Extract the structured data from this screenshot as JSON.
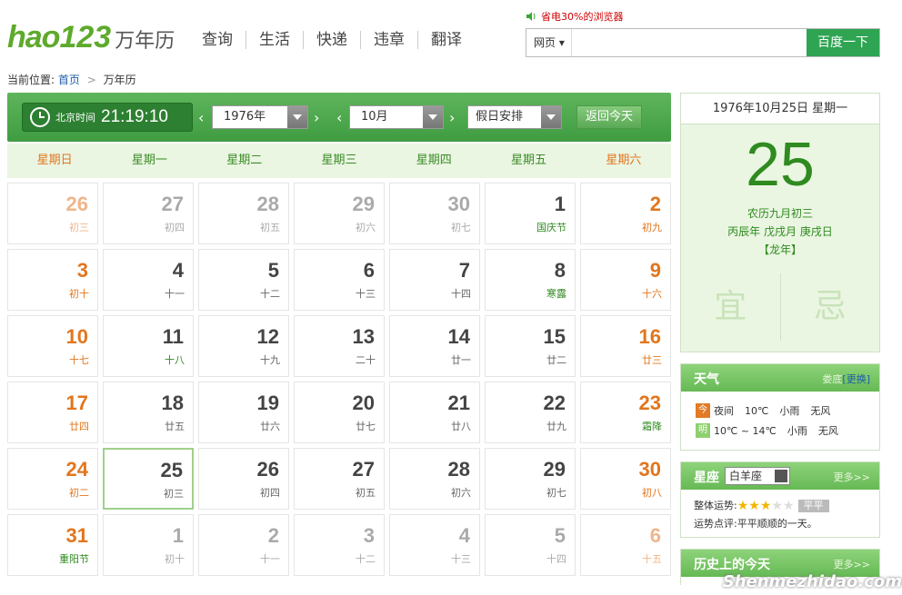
{
  "logo": {
    "hao": "hao",
    "num": "123",
    "suffix": "万年历"
  },
  "topnav": [
    "查询",
    "生活",
    "快递",
    "违章",
    "翻译"
  ],
  "promo": "省电30%的浏览器",
  "search": {
    "scope": "网页",
    "button": "百度一下",
    "placeholder": ""
  },
  "breadcrumb": {
    "prefix": "当前位置:",
    "home": "首页",
    "sep": ">",
    "current": "万年历"
  },
  "toolbar": {
    "clock_label": "北京时间",
    "time": "21:19:10",
    "prev": "‹",
    "next": "›",
    "year": "1976年",
    "month": "10月",
    "holiday": "假日安排",
    "today_button": "返回今天"
  },
  "weekdays": [
    "星期日",
    "星期一",
    "星期二",
    "星期三",
    "星期四",
    "星期五",
    "星期六"
  ],
  "days": [
    {
      "d": "26",
      "l": "初三",
      "out": true
    },
    {
      "d": "27",
      "l": "初四",
      "out": true
    },
    {
      "d": "28",
      "l": "初五",
      "out": true
    },
    {
      "d": "29",
      "l": "初六",
      "out": true
    },
    {
      "d": "30",
      "l": "初七",
      "out": true
    },
    {
      "d": "1",
      "l": "国庆节",
      "fest": true
    },
    {
      "d": "2",
      "l": "初九"
    },
    {
      "d": "3",
      "l": "初十"
    },
    {
      "d": "4",
      "l": "十一"
    },
    {
      "d": "5",
      "l": "十二"
    },
    {
      "d": "6",
      "l": "十三"
    },
    {
      "d": "7",
      "l": "十四"
    },
    {
      "d": "8",
      "l": "寒露",
      "fest": true
    },
    {
      "d": "9",
      "l": "十六"
    },
    {
      "d": "10",
      "l": "十七"
    },
    {
      "d": "11",
      "l": "十八",
      "fest": true
    },
    {
      "d": "12",
      "l": "十九"
    },
    {
      "d": "13",
      "l": "二十"
    },
    {
      "d": "14",
      "l": "廿一"
    },
    {
      "d": "15",
      "l": "廿二"
    },
    {
      "d": "16",
      "l": "廿三"
    },
    {
      "d": "17",
      "l": "廿四"
    },
    {
      "d": "18",
      "l": "廿五"
    },
    {
      "d": "19",
      "l": "廿六"
    },
    {
      "d": "20",
      "l": "廿七"
    },
    {
      "d": "21",
      "l": "廿八"
    },
    {
      "d": "22",
      "l": "廿九"
    },
    {
      "d": "23",
      "l": "霜降",
      "fest": true
    },
    {
      "d": "24",
      "l": "初二"
    },
    {
      "d": "25",
      "l": "初三",
      "sel": true
    },
    {
      "d": "26",
      "l": "初四"
    },
    {
      "d": "27",
      "l": "初五"
    },
    {
      "d": "28",
      "l": "初六"
    },
    {
      "d": "29",
      "l": "初七"
    },
    {
      "d": "30",
      "l": "初八"
    },
    {
      "d": "31",
      "l": "重阳节",
      "fest": true
    },
    {
      "d": "1",
      "l": "初十",
      "out": true
    },
    {
      "d": "2",
      "l": "十一",
      "out": true
    },
    {
      "d": "3",
      "l": "十二",
      "out": true
    },
    {
      "d": "4",
      "l": "十三",
      "out": true
    },
    {
      "d": "5",
      "l": "十四",
      "out": true
    },
    {
      "d": "6",
      "l": "十五",
      "out": true
    }
  ],
  "detail": {
    "header": "1976年10月25日 星期一",
    "day": "25",
    "lunar_line1": "农历九月初三",
    "lunar_line2": "丙辰年 戊戌月 庚戌日",
    "lunar_line3": "【龙年】",
    "yi": "宜",
    "ji": "忌"
  },
  "weather": {
    "title": "天气",
    "city": "娄底",
    "change": "[更换]",
    "rows": [
      {
        "tag": "今",
        "tag_color": "#e27a26",
        "when": "夜间",
        "temp": "10℃",
        "desc": "小雨",
        "wind": "无风"
      },
      {
        "tag": "明",
        "tag_color": "#8fcf6f",
        "when": "",
        "temp": "10℃ ~ 14℃",
        "desc": "小雨",
        "wind": "无风"
      }
    ]
  },
  "horoscope": {
    "title": "星座",
    "sign": "白羊座",
    "more": "更多>>",
    "luck_label": "整体运势:",
    "stars": 3,
    "luck_tag": "平平",
    "comment_label": "运势点评:",
    "comment": "平平顺顺的一天。"
  },
  "history": {
    "title": "历史上的今天",
    "more": "更多>>"
  },
  "watermark": "Shenmezhidao.com",
  "colors": {
    "accent": "#4fa84b",
    "weekend": "#e2761d",
    "festival": "#2f8a1f",
    "search_btn": "#2fa453"
  }
}
